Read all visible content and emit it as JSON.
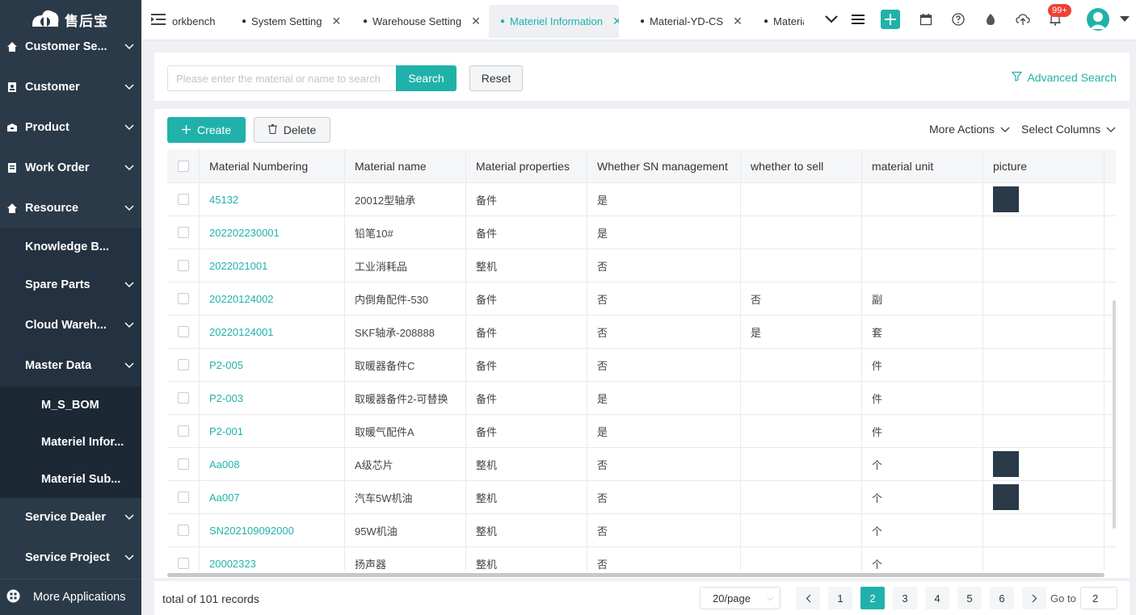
{
  "app": {
    "logo_text": "售后宝",
    "accent_color": "#20b2aa",
    "sidebar_color": "#2b3a48"
  },
  "sidebar": {
    "items": [
      {
        "label": "Customer Se...",
        "icon": "home-icon"
      },
      {
        "label": "Customer",
        "icon": "contact-icon"
      },
      {
        "label": "Product",
        "icon": "box-icon"
      },
      {
        "label": "Work Order",
        "icon": "clipboard-icon"
      },
      {
        "label": "Resource",
        "icon": "home-icon"
      },
      {
        "label": "Knowledge B..."
      },
      {
        "label": "Spare Parts"
      },
      {
        "label": "Cloud Wareh..."
      },
      {
        "label": "Master Data"
      },
      {
        "label": "M_S_BOM"
      },
      {
        "label": "Materiel Infor..."
      },
      {
        "label": "Materiel Sub..."
      },
      {
        "label": "Service Dealer"
      },
      {
        "label": "Service Project"
      }
    ],
    "more_apps": "More Applications"
  },
  "tabs": [
    {
      "label": "orkbench"
    },
    {
      "label": "System Setting"
    },
    {
      "label": "Warehouse Setting"
    },
    {
      "label": "Materiel Information",
      "active": true
    },
    {
      "label": "Material-YD-CS"
    },
    {
      "label": "Materia"
    }
  ],
  "topbar": {
    "notification_count": "99+"
  },
  "search": {
    "placeholder": "Please enter the material or name to search",
    "value": "",
    "search_label": "Search",
    "reset_label": "Reset",
    "advanced_label": "Advanced Search"
  },
  "toolbar": {
    "create_label": "Create",
    "delete_label": "Delete",
    "more_actions_label": "More Actions",
    "select_columns_label": "Select Columns"
  },
  "table": {
    "columns": [
      "Material Numbering",
      "Material name",
      "Material properties",
      "Whether SN management",
      "whether to sell",
      "material unit",
      "picture"
    ],
    "rows": [
      {
        "num": "45132",
        "name": "20012型轴承",
        "prop": "备件",
        "sn": "是",
        "sell": "",
        "unit": "",
        "picture": true
      },
      {
        "num": "202202230001",
        "name": "铅笔10#",
        "prop": "备件",
        "sn": "是",
        "sell": "",
        "unit": "",
        "picture": false
      },
      {
        "num": "2022021001",
        "name": "工业消耗品",
        "prop": "整机",
        "sn": "否",
        "sell": "",
        "unit": "",
        "picture": false
      },
      {
        "num": "20220124002",
        "name": "内倒角配件-530",
        "prop": "备件",
        "sn": "否",
        "sell": "否",
        "unit": "副",
        "picture": false
      },
      {
        "num": "20220124001",
        "name": "SKF轴承-208888",
        "prop": "备件",
        "sn": "否",
        "sell": "是",
        "unit": "套",
        "picture": false
      },
      {
        "num": "P2-005",
        "name": "取暖器备件C",
        "prop": "备件",
        "sn": "否",
        "sell": "",
        "unit": "件",
        "picture": false
      },
      {
        "num": "P2-003",
        "name": "取暖器备件2-可替换",
        "prop": "备件",
        "sn": "是",
        "sell": "",
        "unit": "件",
        "picture": false
      },
      {
        "num": "P2-001",
        "name": "取暖气配件A",
        "prop": "备件",
        "sn": "是",
        "sell": "",
        "unit": "件",
        "picture": false
      },
      {
        "num": "Aa008",
        "name": "A级芯片",
        "prop": "整机",
        "sn": "否",
        "sell": "",
        "unit": "个",
        "picture": true
      },
      {
        "num": "Aa007",
        "name": "汽车5W机油",
        "prop": "整机",
        "sn": "否",
        "sell": "",
        "unit": "个",
        "picture": true
      },
      {
        "num": "SN202109092000",
        "name": "95W机油",
        "prop": "整机",
        "sn": "否",
        "sell": "",
        "unit": "个",
        "picture": false
      },
      {
        "num": "20002323",
        "name": "扬声器",
        "prop": "整机",
        "sn": "否",
        "sell": "",
        "unit": "个",
        "picture": false
      }
    ]
  },
  "pagination": {
    "total_text": "total of 101 records",
    "page_size": "20/page",
    "pages": [
      "1",
      "2",
      "3",
      "4",
      "5",
      "6"
    ],
    "current": "2",
    "goto_label": "Go to",
    "goto_value": "2"
  }
}
